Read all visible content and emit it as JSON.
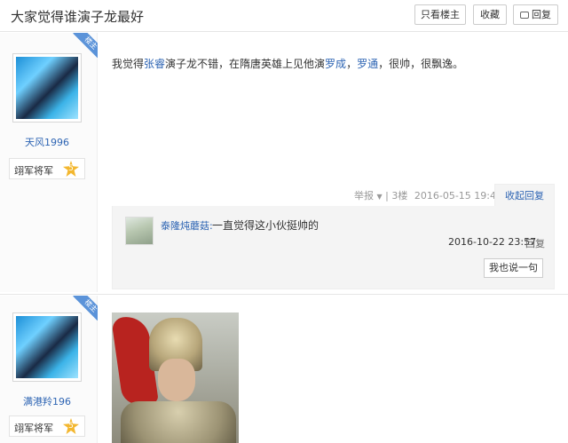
{
  "header": {
    "title": "大家觉得谁演子龙最好",
    "only_lz_label": "只看楼主",
    "favorite_label": "收藏",
    "reply_label": "回复"
  },
  "post1": {
    "badge": "楼主",
    "username": "天风1996",
    "rank_label": "翊军将军",
    "rank_level": "5",
    "content_parts": [
      "我觉得",
      "张睿",
      "演子龙不错，在隋唐英雄上见他演",
      "罗成",
      "，",
      "罗通",
      "，很帅，很飘逸。"
    ],
    "report_label": "举报",
    "floor": "3楼",
    "timestamp": "2016-05-15 19:48",
    "collapse_label": "收起回复",
    "comment": {
      "user": "泰隆炖蘑菇:",
      "text": "一直觉得这小伙挺帅的",
      "time": "2016-10-22 23:57",
      "reply_label": "回复",
      "say_label": "我也说一句"
    }
  },
  "post2": {
    "badge": "楼主",
    "username": "满港羚196",
    "rank_label": "翊军将军",
    "rank_level": "5"
  },
  "colors": {
    "link": "#2d64b3",
    "badge": "#5b93d9",
    "star": "#f3b72f"
  },
  "icons": [
    "reply-icon",
    "star-icon",
    "caret-down-icon"
  ]
}
